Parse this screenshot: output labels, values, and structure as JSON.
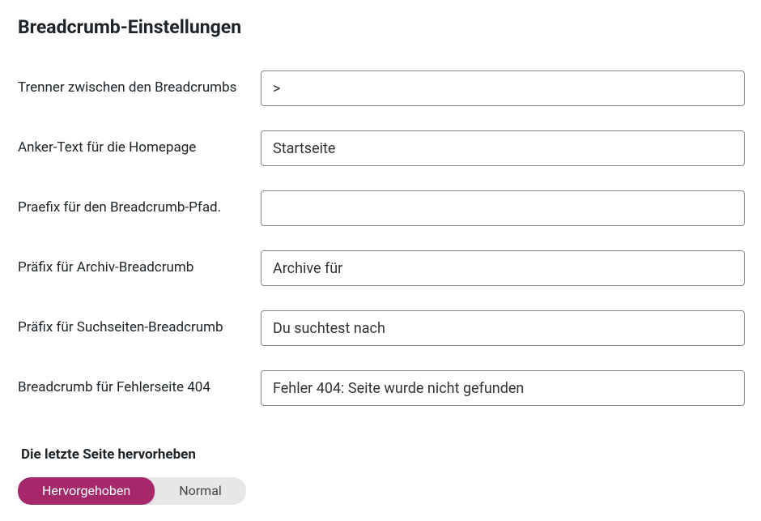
{
  "title": "Breadcrumb-Einstellungen",
  "fields": {
    "separator": {
      "label": "Trenner zwischen den Breadcrumbs",
      "value": ">"
    },
    "home_anchor": {
      "label": "Anker-Text für die Homepage",
      "value": "Startseite"
    },
    "path_prefix": {
      "label": "Praefix für den Breadcrumb-Pfad.",
      "value": ""
    },
    "archive_prefix": {
      "label": "Präfix für Archiv-Breadcrumb",
      "value": "Archive für"
    },
    "search_prefix": {
      "label": "Präfix für Suchseiten-Breadcrumb",
      "value": "Du suchtest nach"
    },
    "error404": {
      "label": "Breadcrumb für Fehlerseite 404",
      "value": "Fehler 404: Seite wurde nicht gefunden"
    }
  },
  "highlight": {
    "label": "Die letzte Seite hervorheben",
    "option_active": "Hervorgehoben",
    "option_normal": "Normal"
  }
}
